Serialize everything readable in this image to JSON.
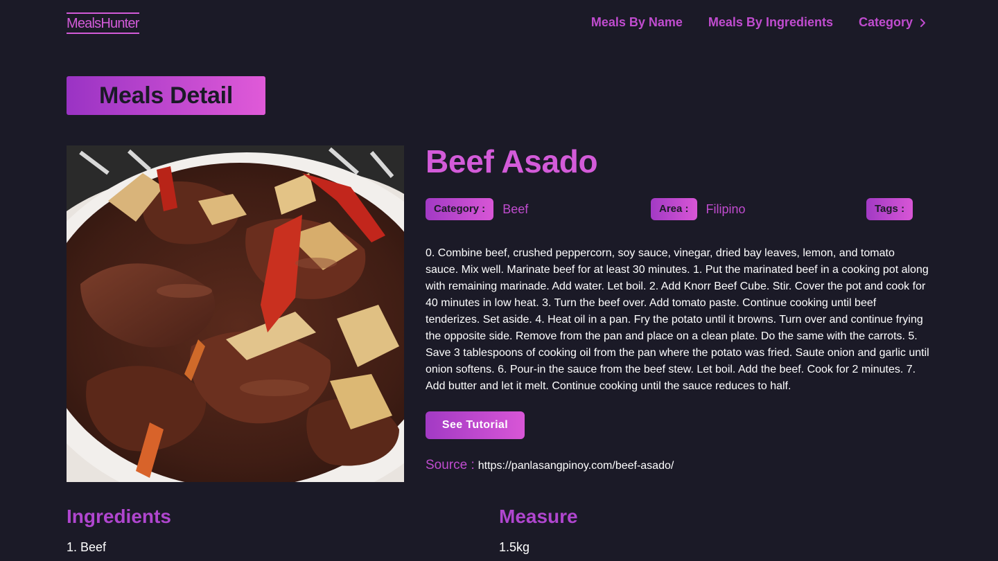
{
  "header": {
    "logo": "MealsHunter",
    "nav": [
      {
        "label": "Meals By Name"
      },
      {
        "label": "Meals By Ingredients"
      },
      {
        "label": "Category"
      }
    ]
  },
  "page_heading": "Meals Detail",
  "meal": {
    "name": "Beef Asado",
    "category_label": "Category :",
    "category": "Beef",
    "area_label": "Area :",
    "area": "Filipino",
    "tags_label": "Tags :",
    "instructions": "0. Combine beef, crushed peppercorn, soy sauce, vinegar, dried bay leaves, lemon, and tomato sauce. Mix well. Marinate beef for at least 30 minutes. 1. Put the marinated beef in a cooking pot along with remaining marinade. Add water. Let boil. 2. Add Knorr Beef Cube. Stir. Cover the pot and cook for 40 minutes in low heat. 3. Turn the beef over. Add tomato paste. Continue cooking until beef tenderizes. Set aside. 4. Heat oil in a pan. Fry the potato until it browns. Turn over and continue frying the opposite side. Remove from the pan and place on a clean plate. Do the same with the carrots. 5. Save 3 tablespoons of cooking oil from the pan where the potato was fried. Saute onion and garlic until onion softens. 6. Pour-in the sauce from the beef stew. Let boil. Add the beef. Cook for 2 minutes. 7. Add butter and let it melt. Continue cooking until the sauce reduces to half.",
    "tutorial_button": "See Tutorial",
    "source_label": "Source :",
    "source_url": "https://panlasangpinoy.com/beef-asado/"
  },
  "table": {
    "headers": [
      "Ingredients",
      "Measure"
    ],
    "rows": [
      {
        "ingredient": "1. Beef",
        "measure": "1.5kg"
      }
    ]
  },
  "icons": {
    "nav_chevron": "chevron-right-icon"
  },
  "colors": {
    "background": "#1b1a27",
    "accent": "#d35bd9",
    "accent_dark": "#a23ac4"
  }
}
